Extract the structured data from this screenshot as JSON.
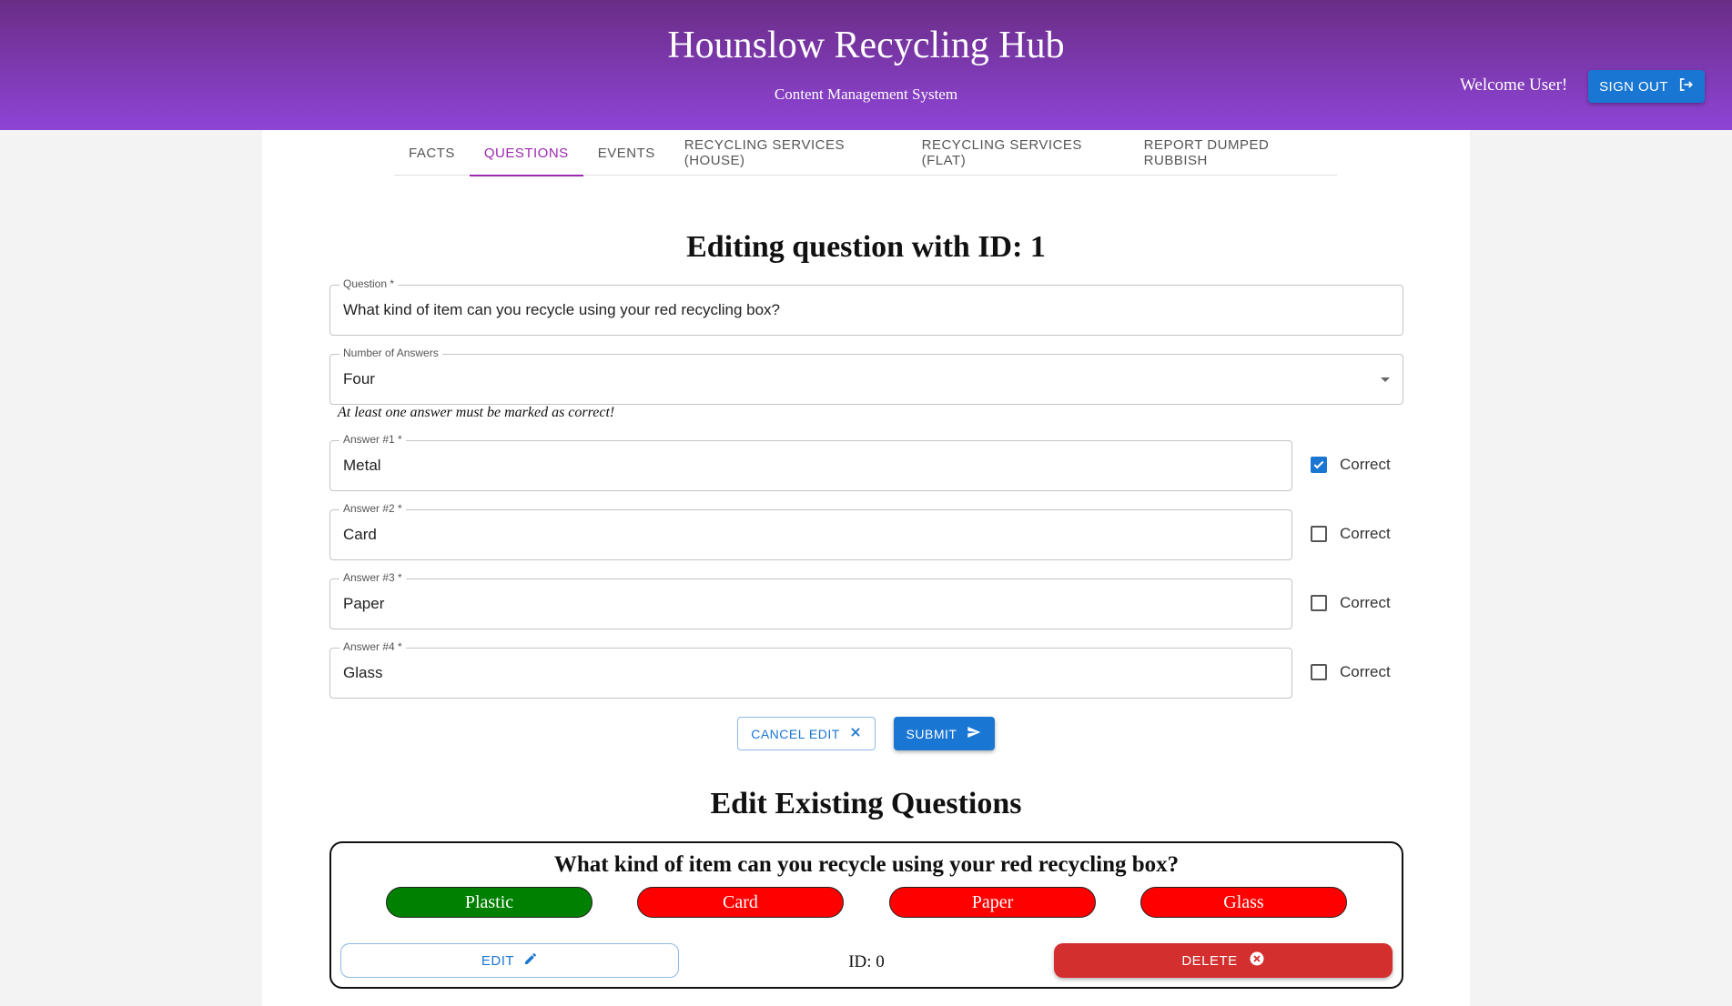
{
  "header": {
    "title": "Hounslow Recycling Hub",
    "subtitle": "Content Management System",
    "welcome": "Welcome User!",
    "signout_label": "SIGN OUT"
  },
  "tabs": [
    {
      "label": "FACTS",
      "active": false
    },
    {
      "label": "QUESTIONS",
      "active": true
    },
    {
      "label": "EVENTS",
      "active": false
    },
    {
      "label": "RECYCLING SERVICES (HOUSE)",
      "active": false
    },
    {
      "label": "RECYCLING SERVICES (FLAT)",
      "active": false
    },
    {
      "label": "REPORT DUMPED RUBBISH",
      "active": false
    }
  ],
  "editor": {
    "heading": "Editing question with ID: 1",
    "question_label": "Question *",
    "question_value": "What kind of item can you recycle using your red recycling box?",
    "num_answers_label": "Number of Answers",
    "num_answers_value": "Four",
    "hint": "At least one answer must be marked as correct!",
    "correct_label": "Correct",
    "answers": [
      {
        "label": "Answer #1 *",
        "value": "Metal",
        "correct": true
      },
      {
        "label": "Answer #2 *",
        "value": "Card",
        "correct": false
      },
      {
        "label": "Answer #3 *",
        "value": "Paper",
        "correct": false
      },
      {
        "label": "Answer #4 *",
        "value": "Glass",
        "correct": false
      }
    ],
    "cancel_label": "CANCEL EDIT",
    "submit_label": "SUBMIT"
  },
  "existing": {
    "heading": "Edit Existing Questions",
    "card": {
      "question": "What kind of item can you recycle using your red recycling box?",
      "answers": [
        {
          "label": "Plastic",
          "correct": true
        },
        {
          "label": "Card",
          "correct": false
        },
        {
          "label": "Paper",
          "correct": false
        },
        {
          "label": "Glass",
          "correct": false
        }
      ],
      "edit_label": "EDIT",
      "id_text": "ID: 0",
      "delete_label": "DELETE"
    }
  },
  "colors": {
    "header_top": "#6a2d86",
    "header_bottom": "#8e44d6",
    "primary": "#1976d2",
    "tab_active": "#9c27b0",
    "delete": "#d32f2f",
    "answer_correct": "#008000",
    "answer_wrong": "#ff0000"
  }
}
